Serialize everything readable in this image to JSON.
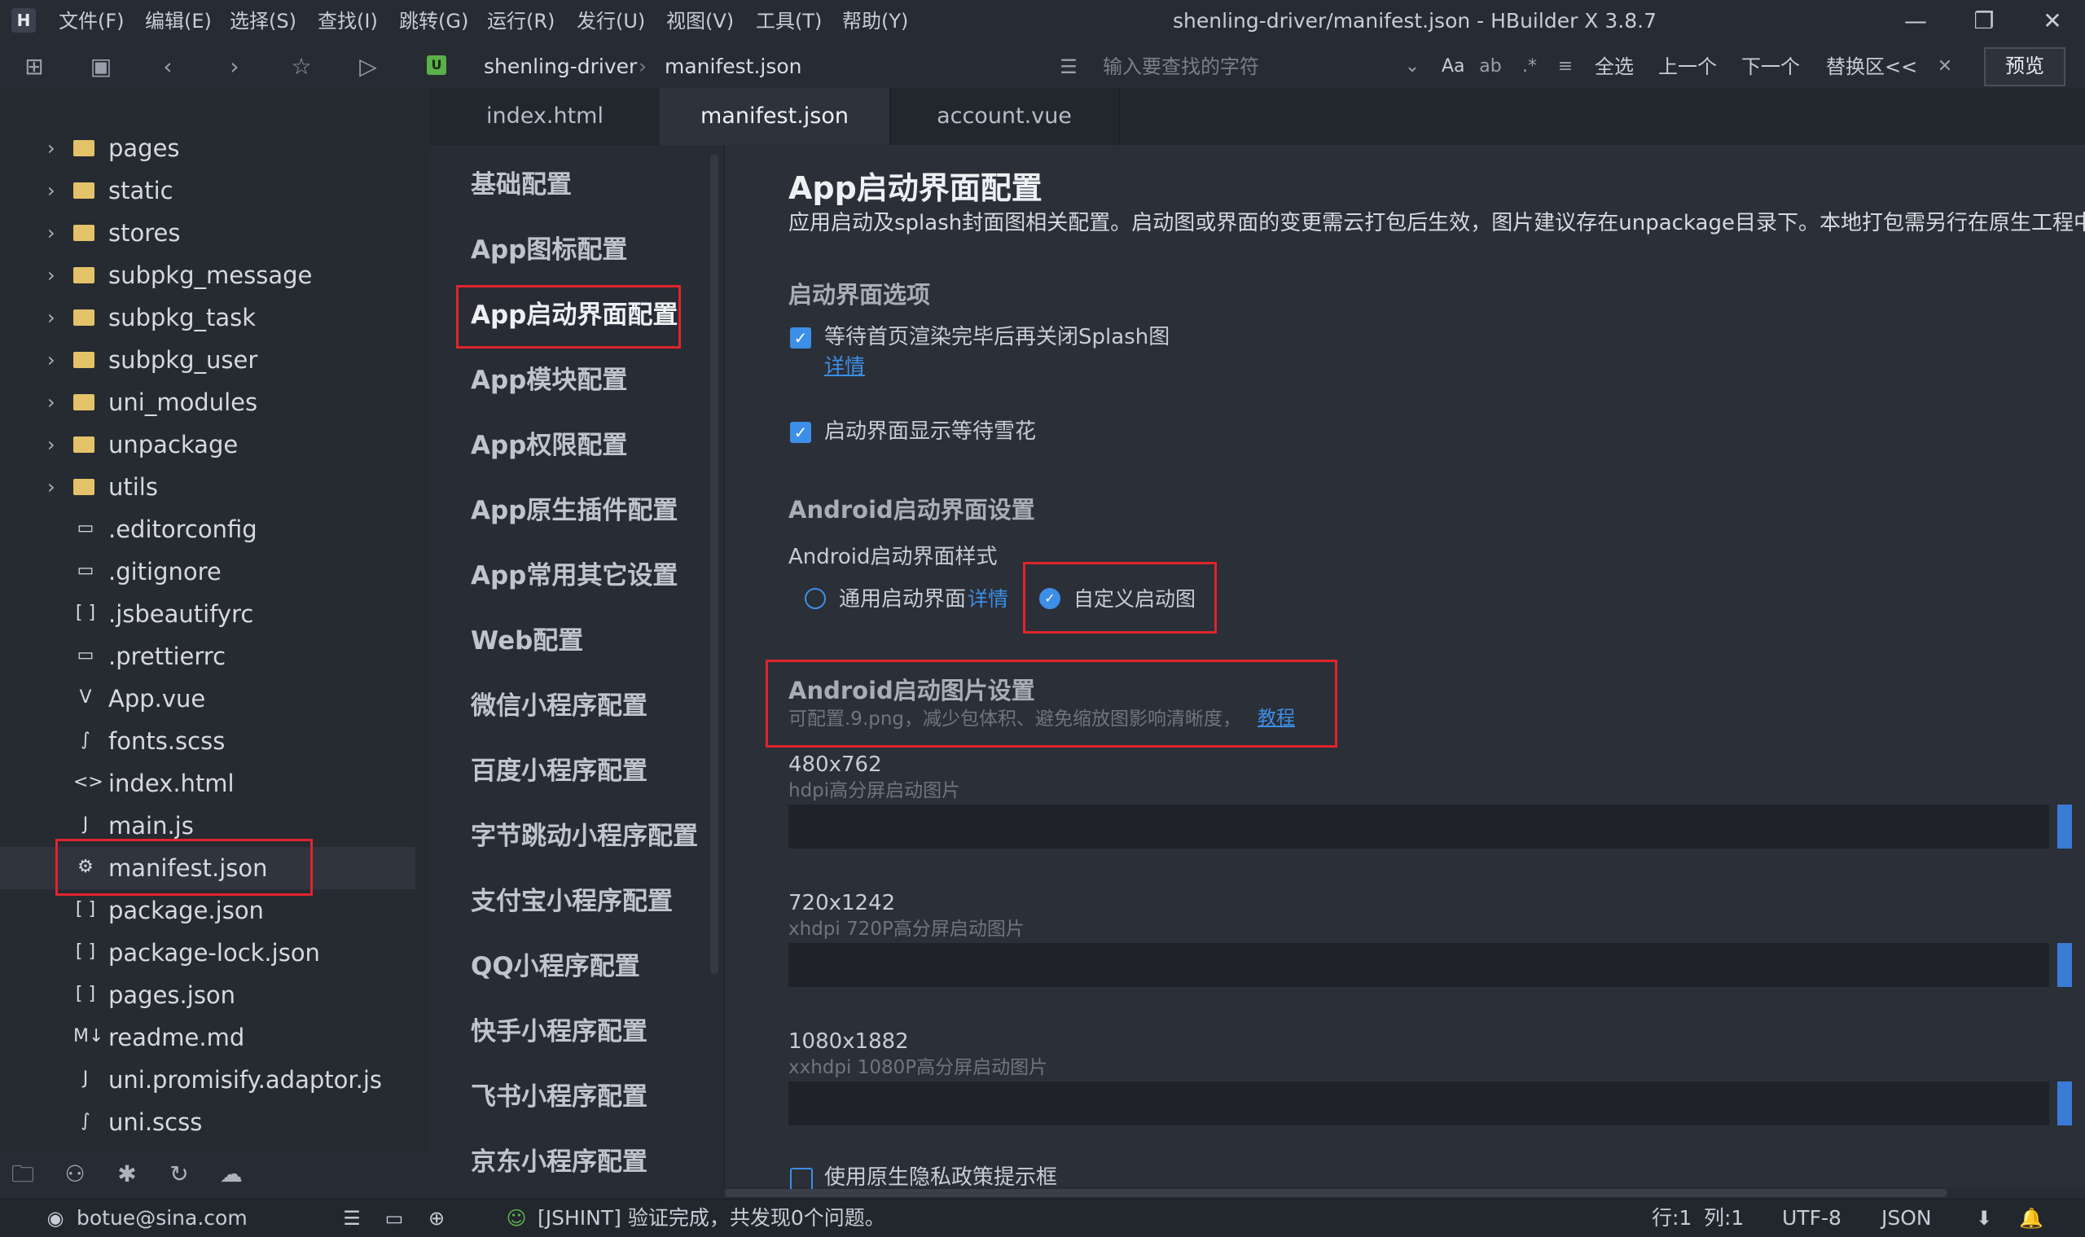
{
  "app": {
    "logo_glyph": "H",
    "title": "shenling-driver/manifest.json - HBuilder X 3.8.7",
    "menu": [
      "文件(F)",
      "编辑(E)",
      "选择(S)",
      "查找(I)",
      "跳转(G)",
      "运行(R)",
      "发行(U)",
      "视图(V)",
      "工具(T)",
      "帮助(Y)"
    ],
    "window_controls": {
      "minimize": "—",
      "restore": "❐",
      "close": "✕"
    }
  },
  "toolbar": {
    "project_badge": "U",
    "breadcrumb": [
      "shenling-driver",
      "manifest.json"
    ],
    "breadcrumb_sep": "›",
    "find_placeholder": "输入要查找的字符",
    "aa": "Aa",
    "select_all": "全选",
    "prev": "上一个",
    "next": "下一个",
    "replace": "替换区<<",
    "preview": "预览"
  },
  "explorer": {
    "items": [
      {
        "label": "pages",
        "type": "folder"
      },
      {
        "label": "static",
        "type": "folder"
      },
      {
        "label": "stores",
        "type": "folder"
      },
      {
        "label": "subpkg_message",
        "type": "folder"
      },
      {
        "label": "subpkg_task",
        "type": "folder"
      },
      {
        "label": "subpkg_user",
        "type": "folder"
      },
      {
        "label": "uni_modules",
        "type": "folder"
      },
      {
        "label": "unpackage",
        "type": "folder"
      },
      {
        "label": "utils",
        "type": "folder"
      },
      {
        "label": ".editorconfig",
        "type": "file",
        "icon": "▭"
      },
      {
        "label": ".gitignore",
        "type": "file",
        "icon": "▭"
      },
      {
        "label": ".jsbeautifyrc",
        "type": "file",
        "icon": "[ ]"
      },
      {
        "label": ".prettierrc",
        "type": "file",
        "icon": "▭"
      },
      {
        "label": "App.vue",
        "type": "file",
        "icon": "V"
      },
      {
        "label": "fonts.scss",
        "type": "file",
        "icon": "∫"
      },
      {
        "label": "index.html",
        "type": "file",
        "icon": "<>"
      },
      {
        "label": "main.js",
        "type": "file",
        "icon": "J"
      },
      {
        "label": "manifest.json",
        "type": "file",
        "icon": "⚙",
        "selected": true
      },
      {
        "label": "package.json",
        "type": "file",
        "icon": "[ ]"
      },
      {
        "label": "package-lock.json",
        "type": "file",
        "icon": "[ ]"
      },
      {
        "label": "pages.json",
        "type": "file",
        "icon": "[ ]"
      },
      {
        "label": "readme.md",
        "type": "file",
        "icon": "M↓"
      },
      {
        "label": "uni.promisify.adaptor.js",
        "type": "file",
        "icon": "J"
      },
      {
        "label": "uni.scss",
        "type": "file",
        "icon": "∫"
      }
    ]
  },
  "tabs": [
    {
      "label": "index.html",
      "active": false
    },
    {
      "label": "manifest.json",
      "active": true
    },
    {
      "label": "account.vue",
      "active": false
    }
  ],
  "settings_nav": [
    "基础配置",
    "App图标配置",
    "App启动界面配置",
    "App模块配置",
    "App权限配置",
    "App原生插件配置",
    "App常用其它设置",
    "Web配置",
    "微信小程序配置",
    "百度小程序配置",
    "字节跳动小程序配置",
    "支付宝小程序配置",
    "QQ小程序配置",
    "快手小程序配置",
    "飞书小程序配置",
    "京东小程序配置"
  ],
  "content": {
    "title": "App启动界面配置",
    "description": "应用启动及splash封面图相关配置。启动图或界面的变更需云打包后生效，图片建议存在unpackage目录下。本地打包需另行在原生工程中",
    "splash_options_title": "启动界面选项",
    "option1_label": "等待首页渲染完毕后再关闭Splash图",
    "option1_link": "详情",
    "option2_label": "启动界面显示等待雪花",
    "android_section_title": "Android启动界面设置",
    "android_style_label": "Android启动界面样式",
    "radio_default": "通用启动界面",
    "radio_default_link": "详情",
    "radio_custom": "自定义启动图",
    "android_image_title": "Android启动图片设置",
    "android_image_hint": "可配置.9.png，减少包体积、避免缩放图影响清晰度，",
    "android_image_link": "教程",
    "images": [
      {
        "size": "480x762",
        "hint": "hdpi高分屏启动图片"
      },
      {
        "size": "720x1242",
        "hint": "xhdpi 720P高分屏启动图片"
      },
      {
        "size": "1080x1882",
        "hint": "xxhdpi 1080P高分屏启动图片"
      }
    ],
    "privacy_label": "使用原生隐私政策提示框"
  },
  "statusbar": {
    "user": "botue@sina.com",
    "lint": "[JSHINT] 验证完成，共发现0个问题。",
    "line": "行:1",
    "col": "列:1",
    "encoding": "UTF-8",
    "language": "JSON"
  },
  "colors": {
    "accent": "#3d8ee6",
    "highlight": "#e0242c",
    "folder": "#e3c26a"
  }
}
